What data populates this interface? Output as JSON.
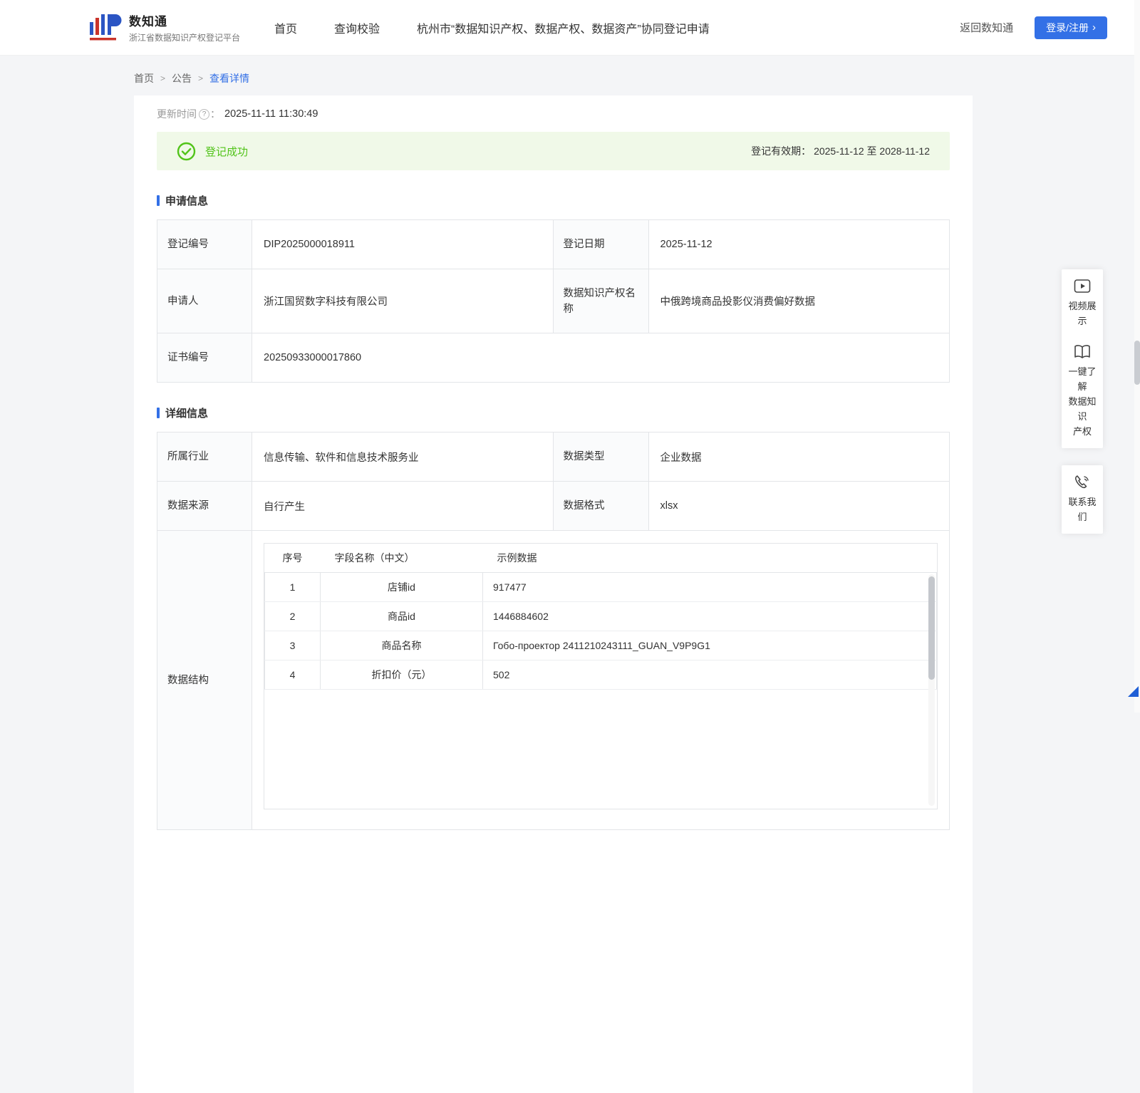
{
  "colors": {
    "accent": "#3370E6",
    "success": "#52C41A",
    "success_bg": "#F0F9E8"
  },
  "header": {
    "logo": {
      "title": "数知通",
      "subtitle": "浙江省数据知识产权登记平台",
      "icon": "iip-logo-mark"
    },
    "nav": [
      {
        "label": "首页"
      },
      {
        "label": "查询校验"
      },
      {
        "label": "杭州市“数据知识产权、数据产权、数据资产”协同登记申请"
      }
    ],
    "back_link": "返回数知通",
    "login_label": "登录/注册",
    "login_chevron": "›"
  },
  "breadcrumb": {
    "home": "首页",
    "section": "公告",
    "current": "查看详情",
    "separator": ">"
  },
  "meta": {
    "update_time_label": "更新时间",
    "help_glyph": "?",
    "colon": "：",
    "update_time": "2025-11-11 11:30:49"
  },
  "status_banner": {
    "text": "登记成功",
    "validity_label": "登记有效期：",
    "validity_value": "2025-11-12 至 2028-11-12"
  },
  "apply_info": {
    "title": "申请信息",
    "reg_no_label": "登记编号",
    "reg_no": "DIP2025000018911",
    "reg_date_label": "登记日期",
    "reg_date": "2025-11-12",
    "applicant_label": "申请人",
    "applicant": "浙江国贸数字科技有限公司",
    "ip_name_label": "数据知识产权名称",
    "ip_name": "中俄跨境商品投影仪消费偏好数据",
    "cert_no_label": "证书编号",
    "cert_no": "20250933000017860"
  },
  "detail_info": {
    "title": "详细信息",
    "industry_label": "所属行业",
    "industry": "信息传输、软件和信息技术服务业",
    "data_type_label": "数据类型",
    "data_type": "企业数据",
    "source_label": "数据来源",
    "source": "自行产生",
    "format_label": "数据格式",
    "format": "xlsx",
    "structure_label": "数据结构",
    "structure_table": {
      "headers": [
        "序号",
        "字段名称（中文）",
        "示例数据"
      ],
      "rows": [
        [
          "1",
          "店铺id",
          "917477"
        ],
        [
          "2",
          "商品id",
          "1446884602"
        ],
        [
          "3",
          "商品名称",
          "Гобо-проектор 2411210243111_GUAN_V9P9G1"
        ],
        [
          "4",
          "折扣价（元）",
          "502"
        ]
      ]
    }
  },
  "float_panel": {
    "video_label": "视频展示",
    "guide_lines": [
      "一键了解",
      "数据知识",
      "产权"
    ],
    "contact_label": "联系我们"
  }
}
